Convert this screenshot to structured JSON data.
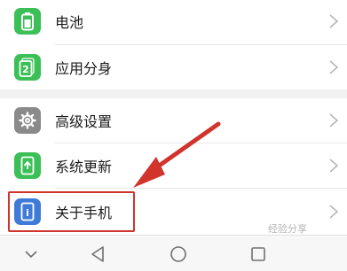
{
  "settings": {
    "items": [
      {
        "label": "电池",
        "icon": "battery-icon",
        "icon_color": "#3bbf57"
      },
      {
        "label": "应用分身",
        "icon": "app-twin-icon",
        "icon_color": "#3bbf57"
      },
      {
        "label": "高级设置",
        "icon": "gear-icon",
        "icon_color": "#8a8a8a"
      },
      {
        "label": "系统更新",
        "icon": "system-update-icon",
        "icon_color": "#3bbf57"
      },
      {
        "label": "关于手机",
        "icon": "about-phone-icon",
        "icon_color": "#3f7bd6"
      }
    ],
    "app_twin_badge": "2",
    "about_badge": "i"
  },
  "annotation": {
    "highlight_color": "#d0342c",
    "highlighted_item": "关于手机"
  },
  "navbar": {
    "buttons": [
      "hide-nav-icon",
      "back-icon",
      "home-icon",
      "recents-icon"
    ]
  },
  "watermark": {
    "text": "经验分享"
  }
}
